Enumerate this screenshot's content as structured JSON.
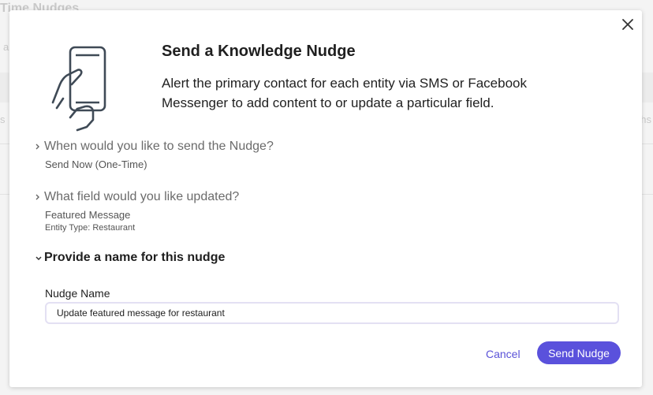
{
  "background": {
    "page_title": "Time Nudges",
    "fragment_a": "a",
    "fragment_s": "s",
    "fragment_hs": "hs"
  },
  "modal": {
    "title": "Send a Knowledge Nudge",
    "description": "Alert the primary contact for each entity via SMS or Facebook Messenger to add content to or update a particular field.",
    "close_icon": "close-icon",
    "illustration_icon": "hand-holding-phone-icon"
  },
  "sections": {
    "when": {
      "question": "When would you like to send the Nudge?",
      "answer": "Send Now (One-Time)"
    },
    "field": {
      "question": "What field would you like updated?",
      "answer": "Featured Message",
      "detail": "Entity Type: Restaurant"
    },
    "name": {
      "heading": "Provide a name for this nudge",
      "field_label": "Nudge Name",
      "value": "Update featured message for restaurant"
    }
  },
  "actions": {
    "cancel_label": "Cancel",
    "send_label": "Send Nudge"
  },
  "colors": {
    "accent": "#5a51dc",
    "text": "#1f1f1f",
    "muted": "#6b6b6b"
  }
}
